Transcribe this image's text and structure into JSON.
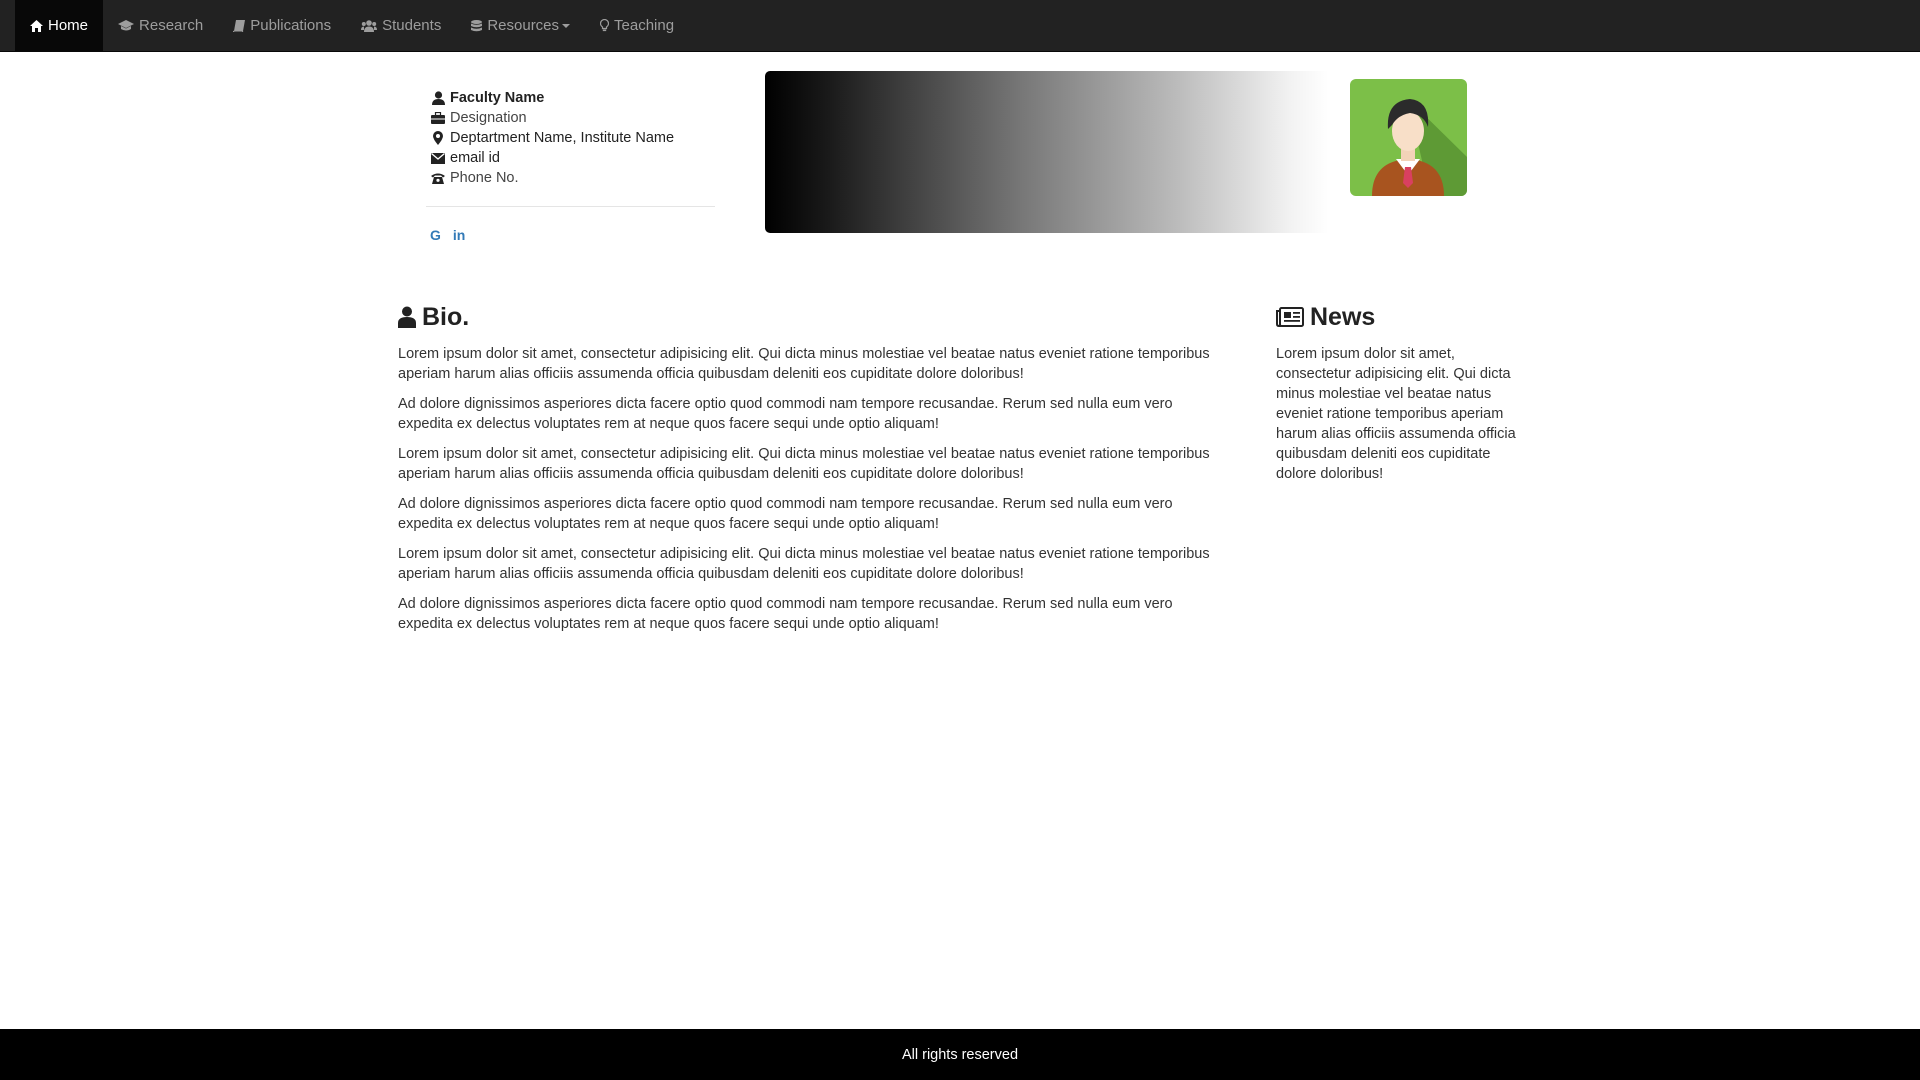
{
  "nav": {
    "items": [
      {
        "label": "Home",
        "icon": "home-icon",
        "active": true
      },
      {
        "label": "Research",
        "icon": "graduation-cap-icon"
      },
      {
        "label": "Publications",
        "icon": "book-icon"
      },
      {
        "label": "Students",
        "icon": "users-icon"
      },
      {
        "label": "Resources",
        "icon": "database-icon",
        "dropdown": true
      },
      {
        "label": "Teaching",
        "icon": "lightbulb-icon"
      }
    ]
  },
  "profile": {
    "name": "Faculty Name",
    "designation": "Designation",
    "department": "Deptartment Name, Institute Name",
    "email": "email id",
    "phone": "Phone No.",
    "social": {
      "google": "G",
      "linkedin": "in"
    }
  },
  "bio": {
    "title": "Bio.",
    "paragraphs": [
      "Lorem ipsum dolor sit amet, consectetur adipisicing elit. Qui dicta minus molestiae vel beatae natus eveniet ratione temporibus aperiam harum alias officiis assumenda officia quibusdam deleniti eos cupiditate dolore doloribus!",
      "Ad dolore dignissimos asperiores dicta facere optio quod commodi nam tempore recusandae. Rerum sed nulla eum vero expedita ex delectus voluptates rem at neque quos facere sequi unde optio aliquam!",
      "Lorem ipsum dolor sit amet, consectetur adipisicing elit. Qui dicta minus molestiae vel beatae natus eveniet ratione temporibus aperiam harum alias officiis assumenda officia quibusdam deleniti eos cupiditate dolore doloribus!",
      "Ad dolore dignissimos asperiores dicta facere optio quod commodi nam tempore recusandae. Rerum sed nulla eum vero expedita ex delectus voluptates rem at neque quos facere sequi unde optio aliquam!",
      "Lorem ipsum dolor sit amet, consectetur adipisicing elit. Qui dicta minus molestiae vel beatae natus eveniet ratione temporibus aperiam harum alias officiis assumenda officia quibusdam deleniti eos cupiditate dolore doloribus!",
      "Ad dolore dignissimos asperiores dicta facere optio quod commodi nam tempore recusandae. Rerum sed nulla eum vero expedita ex delectus voluptates rem at neque quos facere sequi unde optio aliquam!"
    ]
  },
  "news": {
    "title": "News",
    "text": "Lorem ipsum dolor sit amet, consectetur adipisicing elit. Qui dicta minus molestiae vel beatae natus eveniet ratione temporibus aperiam harum alias officiis assumenda officia quibusdam deleniti eos cupiditate dolore doloribus!"
  },
  "footer": {
    "text": "All rights reserved"
  },
  "colors": {
    "navbar": "#222222",
    "nav_active": "#080808",
    "link": "#337ab7",
    "avatar_bg": "#7cbf48",
    "footer": "#000000"
  }
}
